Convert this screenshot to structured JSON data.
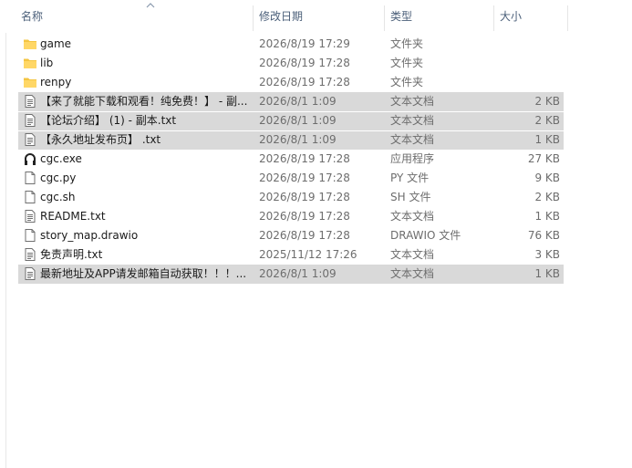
{
  "columns": {
    "name": "名称",
    "date": "修改日期",
    "type": "类型",
    "size": "大小"
  },
  "sort_indicator": "sort-ascending-icon",
  "files": [
    {
      "name": "game",
      "date": "2026/8/19 17:29",
      "type": "文件夹",
      "size": "",
      "icon": "folder-icon",
      "selected": false
    },
    {
      "name": "lib",
      "date": "2026/8/19 17:28",
      "type": "文件夹",
      "size": "",
      "icon": "folder-icon",
      "selected": false
    },
    {
      "name": "renpy",
      "date": "2026/8/19 17:28",
      "type": "文件夹",
      "size": "",
      "icon": "folder-icon",
      "selected": false
    },
    {
      "name": "【来了就能下载和观看！纯免费！】 - 副...",
      "date": "2026/8/1 1:09",
      "type": "文本文档",
      "size": "2 KB",
      "icon": "text-file-icon",
      "selected": true
    },
    {
      "name": "【论坛介绍】 (1) - 副本.txt",
      "date": "2026/8/1 1:09",
      "type": "文本文档",
      "size": "2 KB",
      "icon": "text-file-icon",
      "selected": true
    },
    {
      "name": "【永久地址发布页】 .txt",
      "date": "2026/8/1 1:09",
      "type": "文本文档",
      "size": "1 KB",
      "icon": "text-file-icon",
      "selected": true
    },
    {
      "name": "cgc.exe",
      "date": "2026/8/19 17:28",
      "type": "应用程序",
      "size": "27 KB",
      "icon": "exe-icon",
      "selected": false
    },
    {
      "name": "cgc.py",
      "date": "2026/8/19 17:28",
      "type": "PY 文件",
      "size": "9 KB",
      "icon": "file-icon",
      "selected": false
    },
    {
      "name": "cgc.sh",
      "date": "2026/8/19 17:28",
      "type": "SH 文件",
      "size": "2 KB",
      "icon": "file-icon",
      "selected": false
    },
    {
      "name": "README.txt",
      "date": "2026/8/19 17:28",
      "type": "文本文档",
      "size": "1 KB",
      "icon": "text-file-icon",
      "selected": false
    },
    {
      "name": "story_map.drawio",
      "date": "2026/8/19 17:28",
      "type": "DRAWIO 文件",
      "size": "76 KB",
      "icon": "file-icon",
      "selected": false
    },
    {
      "name": "免责声明.txt",
      "date": "2025/11/12 17:26",
      "type": "文本文档",
      "size": "3 KB",
      "icon": "text-file-icon",
      "selected": false
    },
    {
      "name": "最新地址及APP请发邮箱自动获取！！！...",
      "date": "2026/8/1 1:09",
      "type": "文本文档",
      "size": "1 KB",
      "icon": "text-file-icon",
      "selected": true
    }
  ],
  "colors": {
    "folder": "#f4c542",
    "selection": "#d9d9d9",
    "header_text": "#4c607a"
  }
}
